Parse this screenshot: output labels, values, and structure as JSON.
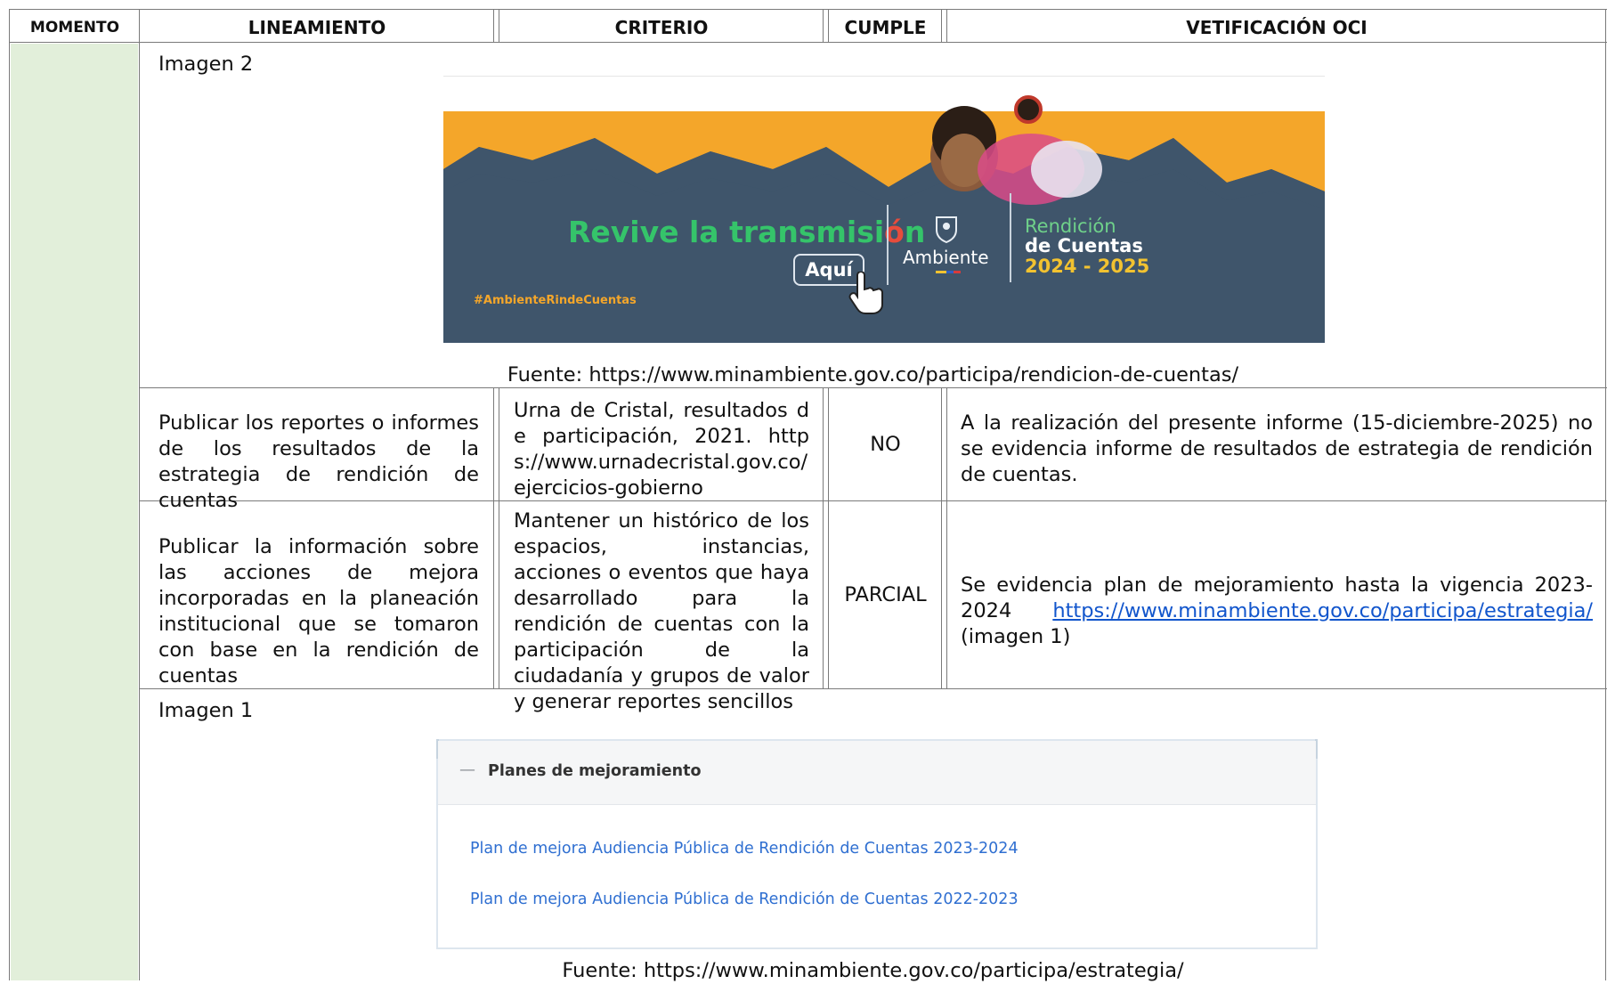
{
  "header": {
    "momento": "MOMENTO",
    "lineamiento": "LINEAMIENTO",
    "criterio": "CRITERIO",
    "cumple": "CUMPLE",
    "verificacion": "VETIFICACIÓN OCI"
  },
  "section_imagen2": {
    "label": "Imagen 2",
    "banner": {
      "headline_main": "Revive la transmisi",
      "headline_accent": "ó",
      "headline_end": "n",
      "button": "Aquí",
      "hashtag": "#AmbienteRindeCuentas",
      "brand": "Ambiente",
      "event_line1": "Rendición",
      "event_line2": "de Cuentas",
      "event_line3": "2024 - 2025",
      "colors": {
        "navy": "#3f556b",
        "orange": "#f4a62a",
        "green": "#35c46a",
        "lime": "#6fd18a",
        "yellow": "#f2c230"
      }
    },
    "source": "Fuente: https://www.minambiente.gov.co/participa/rendicion-de-cuentas/"
  },
  "rows": [
    {
      "lineamiento": "Publicar los reportes o informes de los resultados de la estrategia de rendición de cuentas",
      "criterio": "Urna de Cristal, resultados de participación, 2021. https://www.urnadecristal.gov.co/ejercicios-gobierno",
      "cumple": "NO",
      "verificacion": "A la realización del presente informe (15-diciembre-2025) no se evidencia informe de resultados de estrategia de rendición de cuentas."
    },
    {
      "lineamiento": "Publicar la información sobre las acciones de mejora incorporadas en la planeación institucional que se tomaron con base en la rendición de cuentas",
      "criterio": "Mantener un histórico de los espacios, instancias, acciones o eventos que haya desarrollado para la rendición de cuentas con la participación de la ciudadanía y grupos de valor y generar reportes sencillos",
      "cumple": "PARCIAL",
      "verificacion_text": "Se evidencia plan de mejoramiento hasta la vigencia 2023-2024",
      "verificacion_link": "https://www.minambiente.gov.co/participa/estrategia/",
      "verificacion_suffix": " (imagen 1)"
    }
  ],
  "section_imagen1": {
    "label": "Imagen 1",
    "card": {
      "collapse_symbol": "—",
      "title": "Planes de mejoramiento",
      "links": [
        "Plan de mejora Audiencia Pública de Rendición de Cuentas 2023-2024",
        "Plan de mejora Audiencia Pública de Rendición de Cuentas 2022-2023"
      ]
    },
    "source": "Fuente: https://www.minambiente.gov.co/participa/estrategia/"
  },
  "colors": {
    "momento_column": "#e2efda",
    "border": "#7a7a7a",
    "link": "#1155cc"
  }
}
